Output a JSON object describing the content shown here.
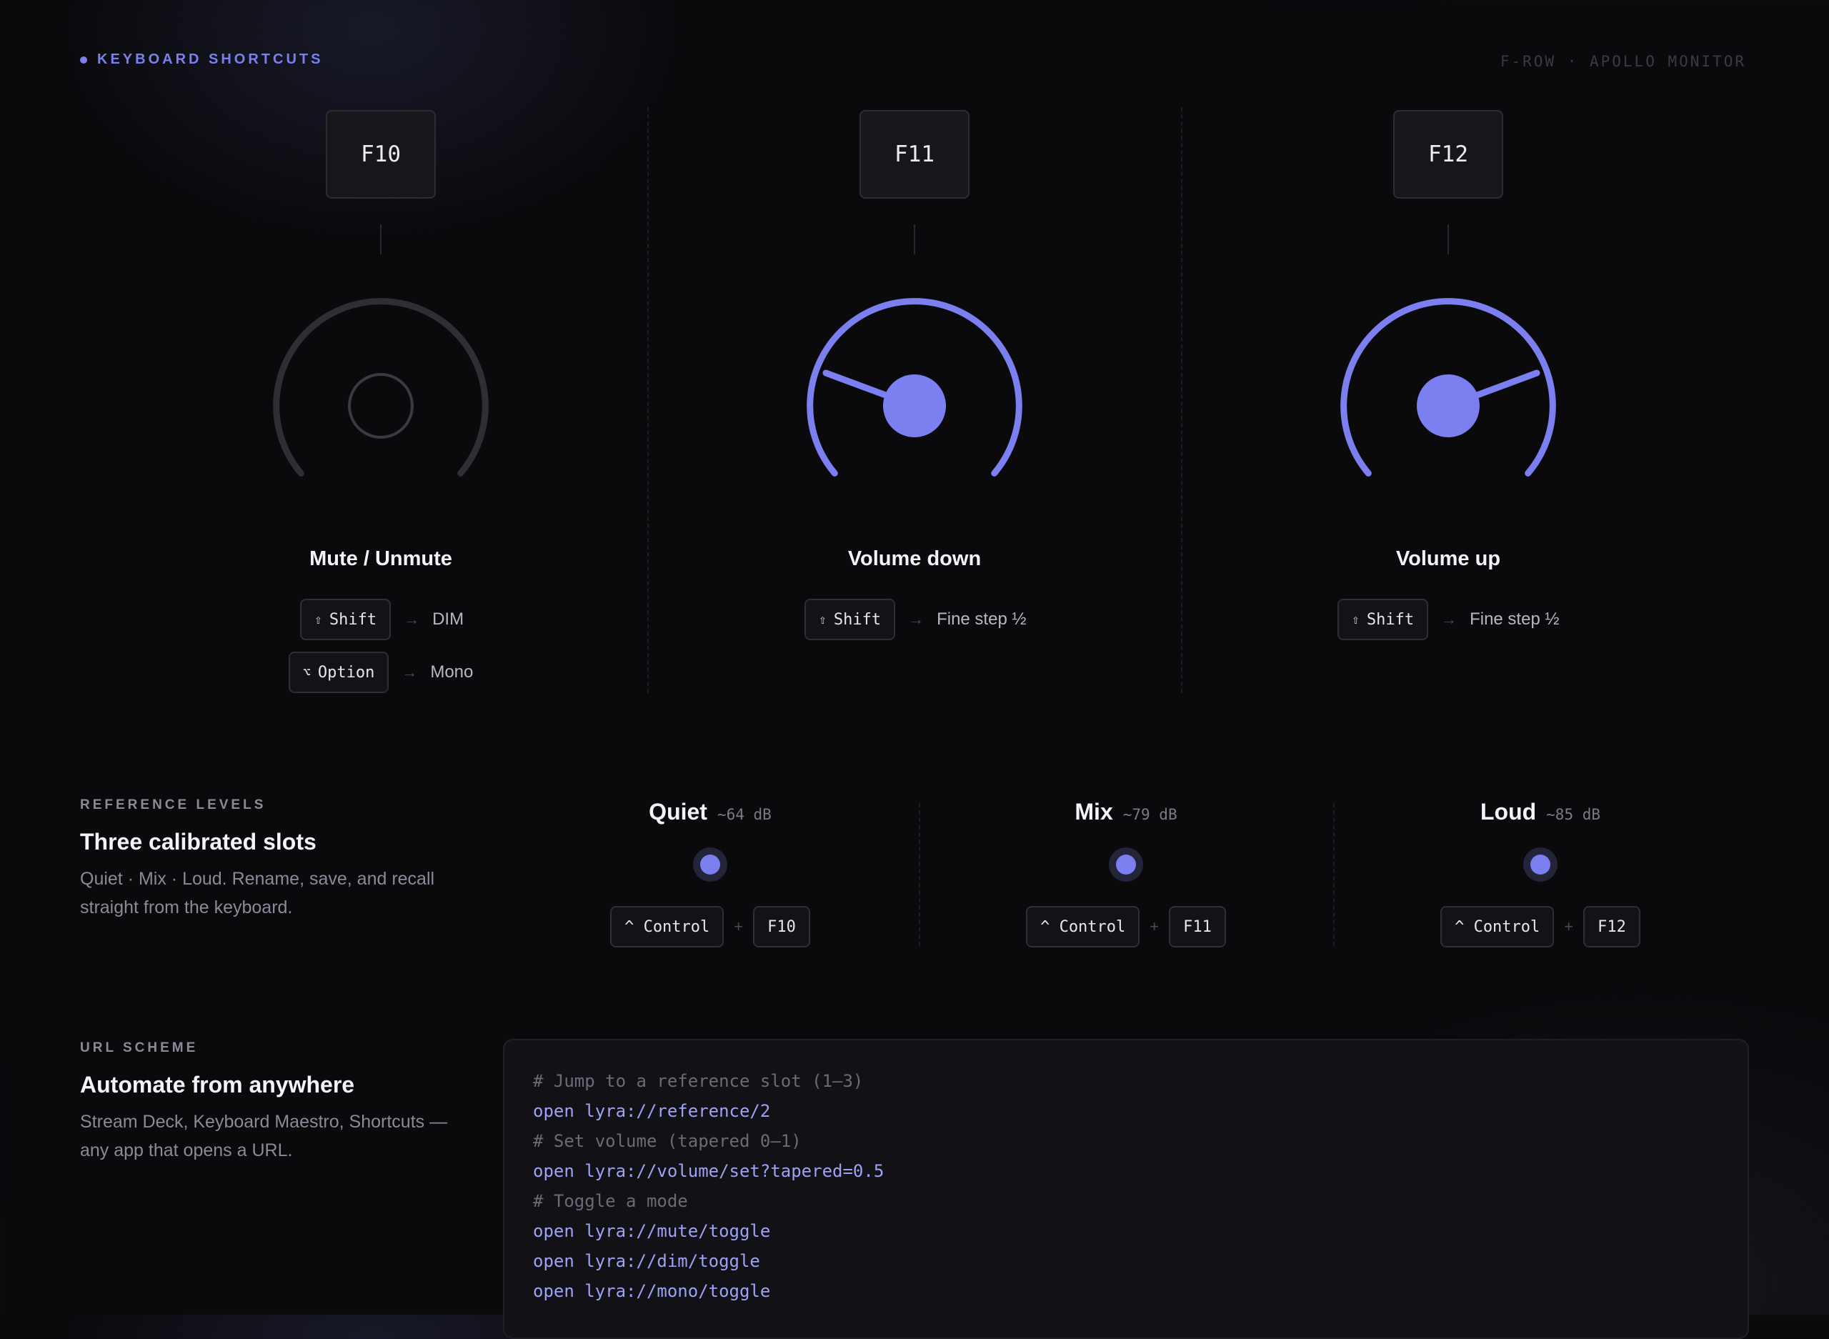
{
  "header": {
    "section_label": "KEYBOARD SHORTCUTS",
    "context": "F-ROW · APOLLO MONITOR"
  },
  "colors": {
    "accent": "#7b7ff0",
    "inactive": "#2e2e34",
    "background": "#0a0a0d"
  },
  "shortcuts": [
    {
      "key": "F10",
      "title": "Mute / Unmute",
      "knob_state": "inactive",
      "modifiers": [
        {
          "icon": "⇧",
          "label": "Shift",
          "result": "DIM"
        },
        {
          "icon": "⌥",
          "label": "Option",
          "result": "Mono"
        }
      ]
    },
    {
      "key": "F11",
      "title": "Volume down",
      "knob_state": "active",
      "knob_pointer": "down",
      "modifiers": [
        {
          "icon": "⇧",
          "label": "Shift",
          "result": "Fine step ½"
        }
      ]
    },
    {
      "key": "F12",
      "title": "Volume up",
      "knob_state": "active",
      "knob_pointer": "up",
      "modifiers": [
        {
          "icon": "⇧",
          "label": "Shift",
          "result": "Fine step ½"
        }
      ]
    }
  ],
  "arrow": "→",
  "reference": {
    "eyebrow": "REFERENCE LEVELS",
    "title": "Three calibrated slots",
    "description": "Quiet · Mix · Loud. Rename, save, and recall straight from the keyboard.",
    "plus": "+",
    "slots": [
      {
        "name": "Quiet",
        "level": "~64 dB",
        "modifier": "^ Control",
        "key": "F10"
      },
      {
        "name": "Mix",
        "level": "~79 dB",
        "modifier": "^ Control",
        "key": "F11"
      },
      {
        "name": "Loud",
        "level": "~85 dB",
        "modifier": "^ Control",
        "key": "F12"
      }
    ]
  },
  "url_scheme": {
    "eyebrow": "URL SCHEME",
    "title": "Automate from anywhere",
    "description": "Stream Deck, Keyboard Maestro, Shortcuts — any app that opens a URL.",
    "lines": [
      {
        "type": "comment",
        "text": "# Jump to a reference slot (1–3)"
      },
      {
        "type": "cmd",
        "text": "open lyra://reference/2"
      },
      {
        "type": "comment",
        "text": "# Set volume (tapered 0–1)"
      },
      {
        "type": "cmd",
        "text": "open lyra://volume/set?tapered=0.5"
      },
      {
        "type": "comment",
        "text": "# Toggle a mode"
      },
      {
        "type": "cmd",
        "text": "open lyra://mute/toggle"
      },
      {
        "type": "cmd",
        "text": "open lyra://dim/toggle"
      },
      {
        "type": "cmd",
        "text": "open lyra://mono/toggle"
      }
    ]
  }
}
